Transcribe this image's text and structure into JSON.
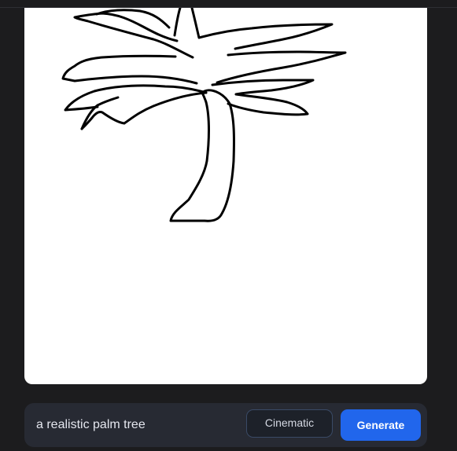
{
  "prompt": {
    "value": "a realistic palm tree"
  },
  "style_button": {
    "label": "Cinematic"
  },
  "generate_button": {
    "label": "Generate"
  },
  "colors": {
    "background": "#1c1c1e",
    "prompt_bar": "#272a33",
    "accent": "#2166ec",
    "canvas": "#ffffff",
    "stroke": "#000000"
  },
  "icons": [
    "palm-tree-sketch"
  ]
}
